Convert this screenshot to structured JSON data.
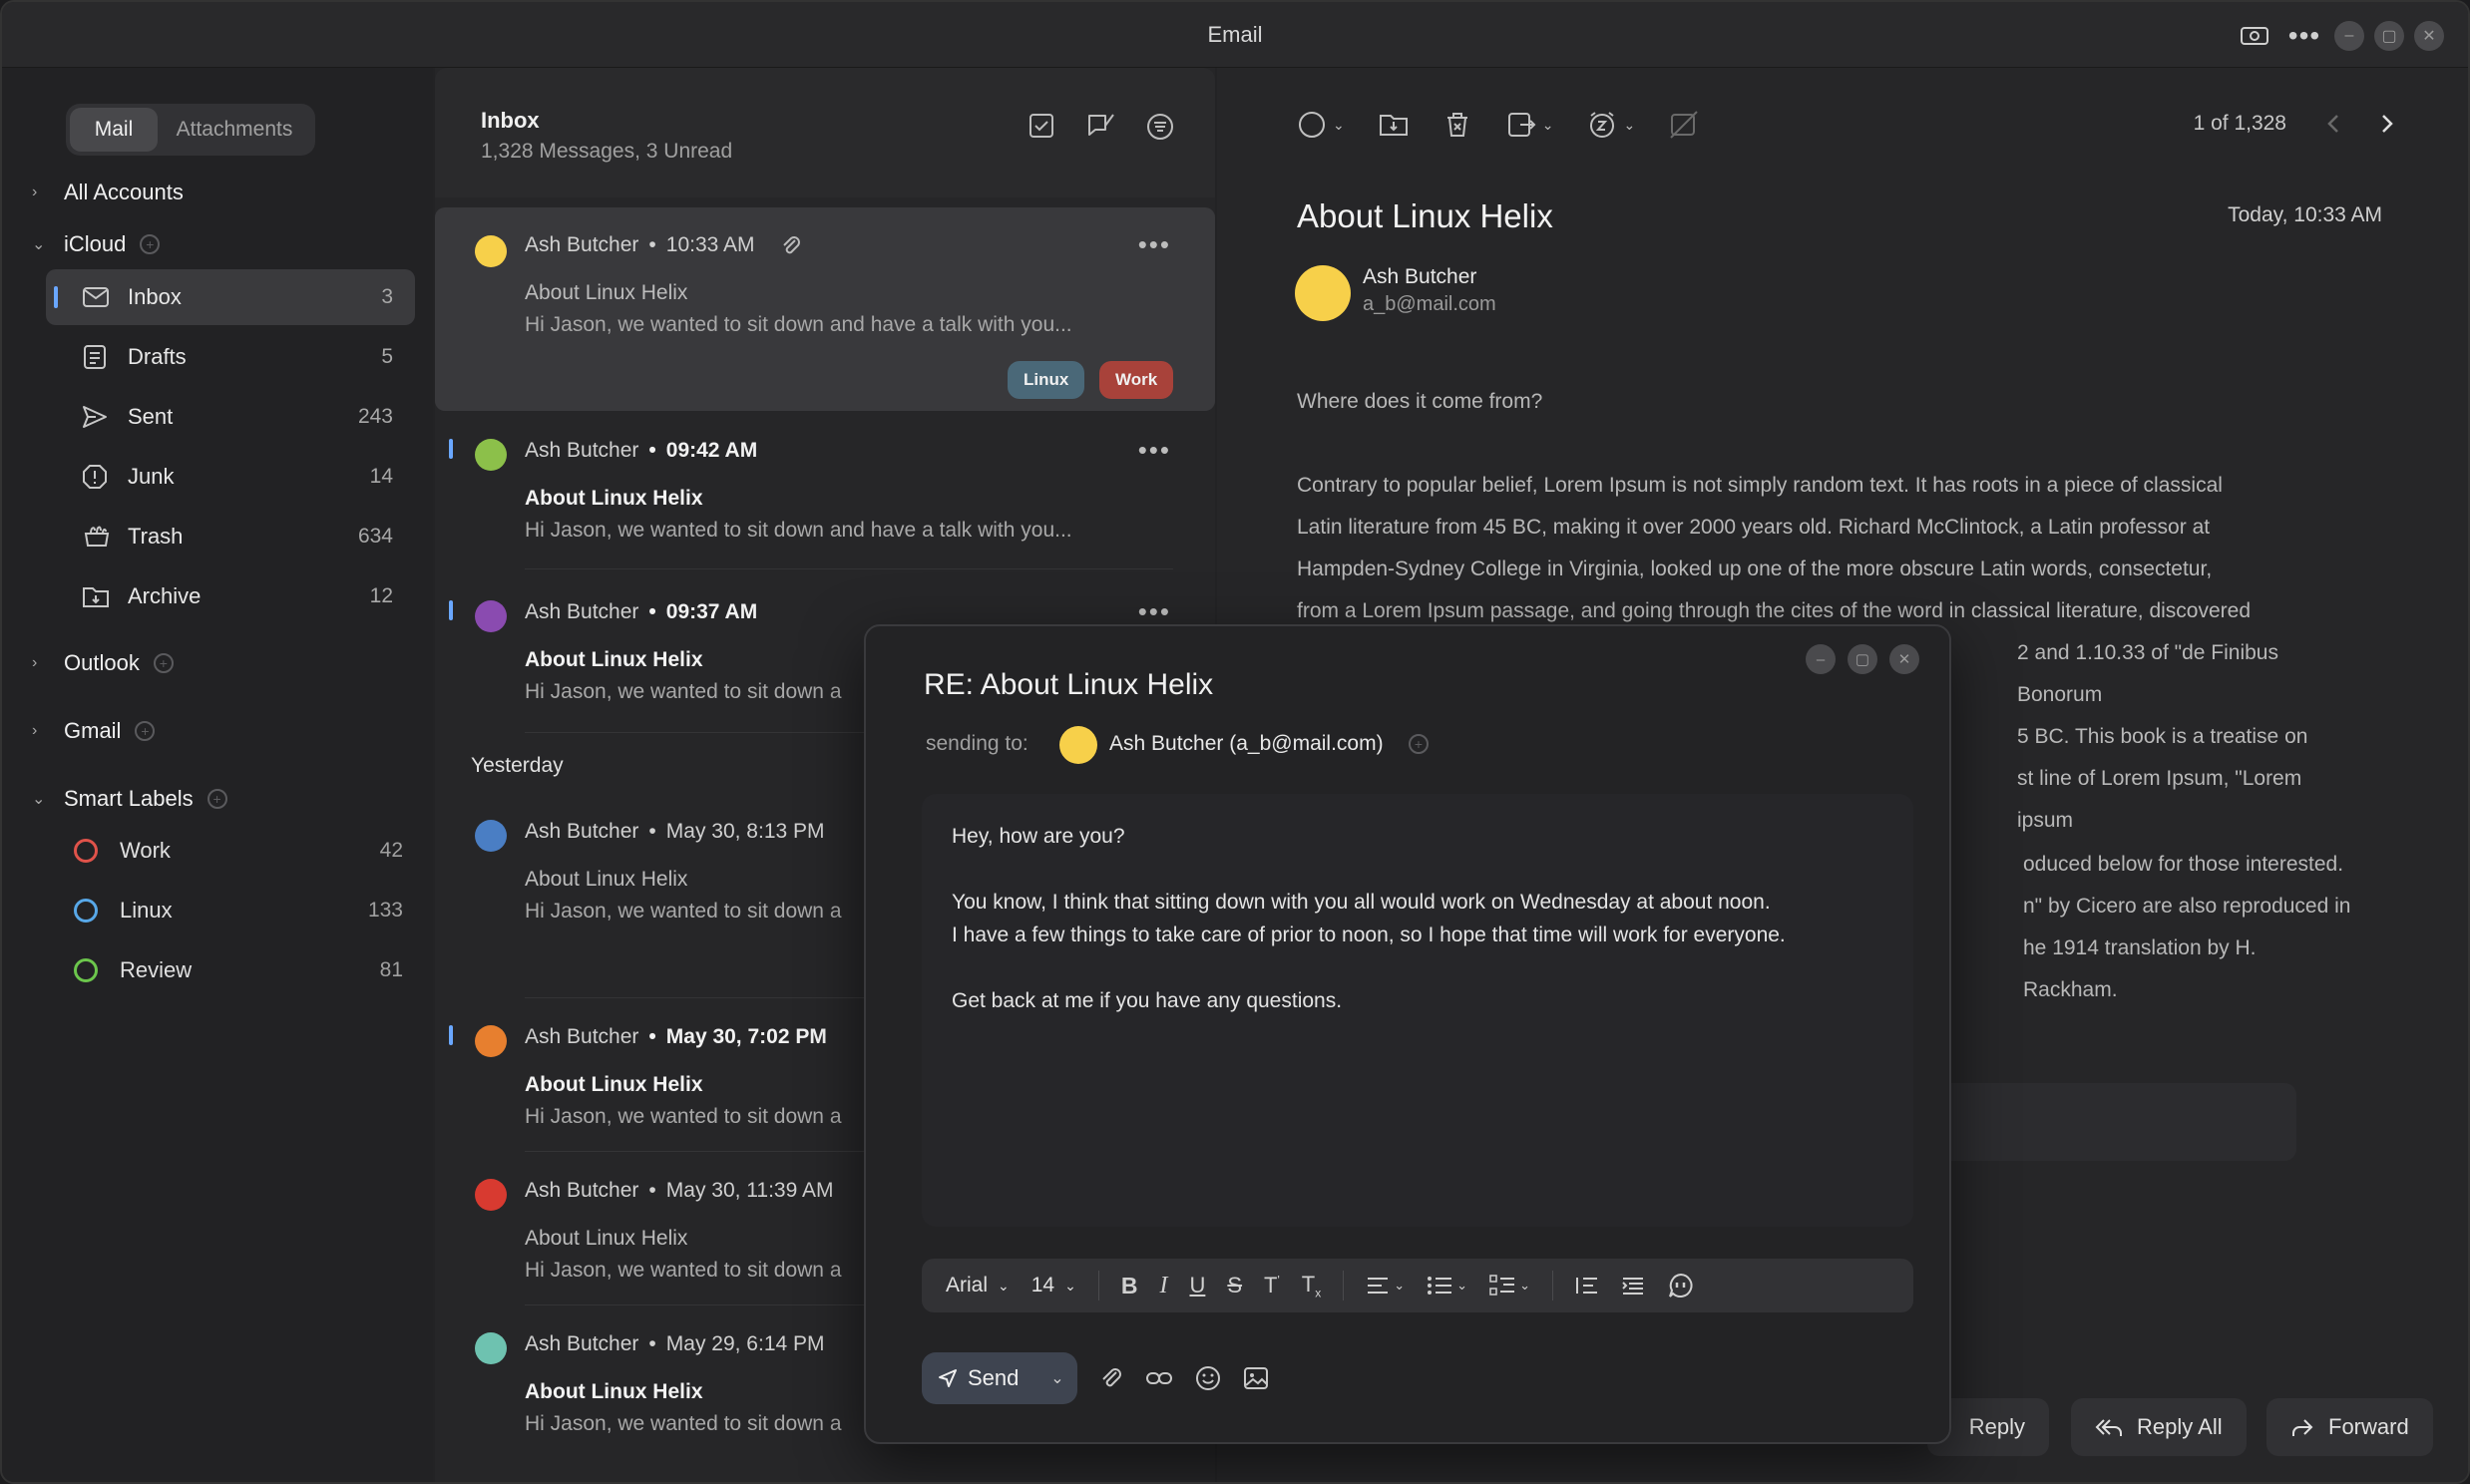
{
  "window": {
    "title": "Email"
  },
  "sidebar": {
    "segments": [
      "Mail",
      "Attachments"
    ],
    "accounts": {
      "all": "All Accounts",
      "icloud": "iCloud",
      "outlook": "Outlook",
      "gmail": "Gmail",
      "smart_labels": "Smart Labels"
    },
    "folders": [
      {
        "label": "Inbox",
        "count": "3",
        "icon": "inbox-icon"
      },
      {
        "label": "Drafts",
        "count": "5",
        "icon": "drafts-icon"
      },
      {
        "label": "Sent",
        "count": "243",
        "icon": "send-icon"
      },
      {
        "label": "Junk",
        "count": "14",
        "icon": "junk-icon"
      },
      {
        "label": "Trash",
        "count": "634",
        "icon": "trash-icon"
      },
      {
        "label": "Archive",
        "count": "12",
        "icon": "archive-icon"
      }
    ],
    "labels": [
      {
        "label": "Work",
        "count": "42",
        "color": "#e0534a"
      },
      {
        "label": "Linux",
        "count": "133",
        "color": "#58a8e8"
      },
      {
        "label": "Review",
        "count": "81",
        "color": "#6cc64c"
      }
    ]
  },
  "list": {
    "title": "Inbox",
    "subtitle": "1,328 Messages, 3 Unread",
    "group_yesterday": "Yesterday",
    "messages": [
      {
        "sender": "Ash Butcher",
        "time": "10:33 AM",
        "subject": "About Linux Helix",
        "preview": "Hi Jason, we wanted to sit down and have a talk with you...",
        "avatar": "#f7d04a",
        "tags": [
          "Linux",
          "Work"
        ]
      },
      {
        "sender": "Ash Butcher",
        "time": "09:42 AM",
        "subject": "About Linux Helix",
        "preview": "Hi Jason, we wanted to sit down and have a talk with you...",
        "avatar": "#8cc04a"
      },
      {
        "sender": "Ash Butcher",
        "time": "09:37 AM",
        "subject": "About Linux Helix",
        "preview": "Hi Jason, we wanted to sit down a",
        "avatar": "#8a4bb0"
      },
      {
        "sender": "Ash Butcher",
        "time": "May 30, 8:13 PM",
        "subject": "About Linux Helix",
        "preview": "Hi Jason, we wanted to sit down a",
        "avatar": "#4a7ec4"
      },
      {
        "sender": "Ash Butcher",
        "time": "May 30, 7:02 PM",
        "subject": "About Linux Helix",
        "preview": "Hi Jason, we wanted to sit down a",
        "avatar": "#e77f2f"
      },
      {
        "sender": "Ash Butcher",
        "time": "May 30, 11:39 AM",
        "subject": "About Linux Helix",
        "preview": "Hi Jason, we wanted to sit down a",
        "avatar": "#d83a30"
      },
      {
        "sender": "Ash Butcher",
        "time": "May 29, 6:14 PM",
        "subject": "About Linux Helix",
        "preview": "Hi Jason, we wanted to sit down a",
        "avatar": "#6ec2b0"
      }
    ],
    "tag_colors": {
      "Linux": "#4a6878",
      "Work": "#a8423a"
    }
  },
  "reader": {
    "pager": "1 of 1,328",
    "subject": "About Linux Helix",
    "date": "Today, 10:33 AM",
    "sender_name": "Ash Butcher",
    "sender_email": "a_b@mail.com",
    "heading": "Where does it come from?",
    "para1": [
      "Contrary to popular belief, Lorem Ipsum is not simply random text. It has roots in a piece of classical",
      "Latin literature from 45 BC, making it over 2000 years old. Richard McClintock, a Latin professor at",
      "Hampden-Sydney College in Virginia, looked up one of the more obscure Latin words, consectetur,",
      "from a Lorem Ipsum passage, and going through the cites of the word in classical literature, discovered",
      "2 and 1.10.33 of \"de Finibus Bonorum",
      "5 BC. This book is a treatise on",
      "st line of Lorem Ipsum, \"Lorem ipsum"
    ],
    "para2": [
      "oduced below for those interested.",
      "n\" by Cicero are also reproduced in",
      "he 1914 translation by H. Rackham."
    ],
    "buttons": {
      "reply": "Reply",
      "reply_all": "Reply All",
      "forward": "Forward"
    }
  },
  "compose": {
    "title": "RE: About Linux Helix",
    "to_label": "sending to:",
    "to_value": "Ash Butcher (a_b@mail.com)",
    "body": {
      "line1": "Hey, how are you?",
      "line2": "You know, I think that sitting down with you all would work on Wednesday at about noon.",
      "line3": "I have a few things to take care of prior to noon, so I hope that time will work for everyone.",
      "line4": "Get back at me if you have any questions."
    },
    "font": "Arial",
    "font_size": "14",
    "send_label": "Send"
  }
}
